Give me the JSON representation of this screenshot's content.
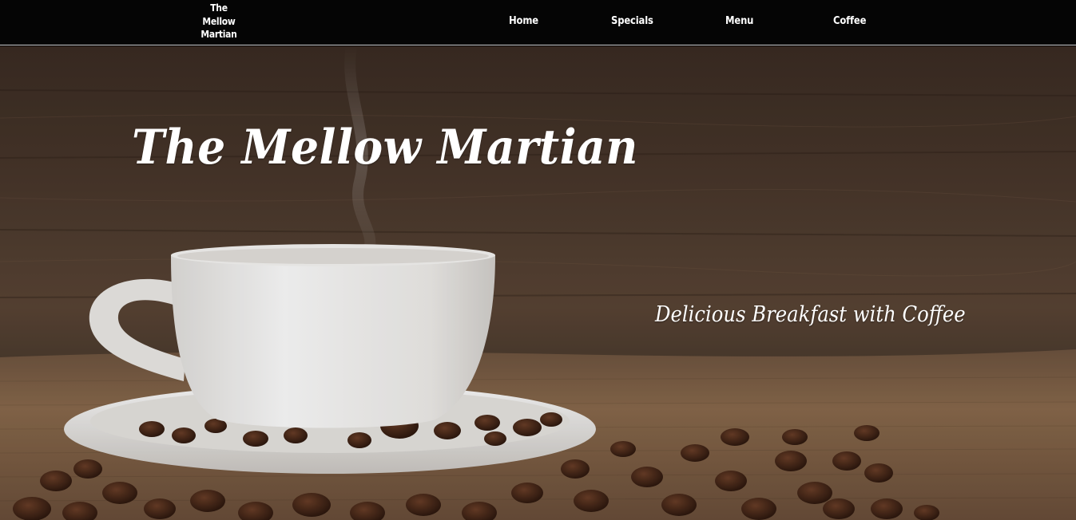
{
  "brand": {
    "line1": "The",
    "line2": "Mellow",
    "line3": "Martian"
  },
  "nav": {
    "home": "Home",
    "specials": "Specials",
    "menu": "Menu",
    "coffee": "Coffee"
  },
  "hero": {
    "title": "The Mellow Martian",
    "tagline": "Delicious Breakfast with Coffee"
  },
  "colors": {
    "nav_background": "#050505",
    "text": "#ffffff",
    "wood": "#3b2c23",
    "burlap": "#8b6b4c",
    "cup": "#f4f3f1",
    "bean": "#3a2116"
  }
}
